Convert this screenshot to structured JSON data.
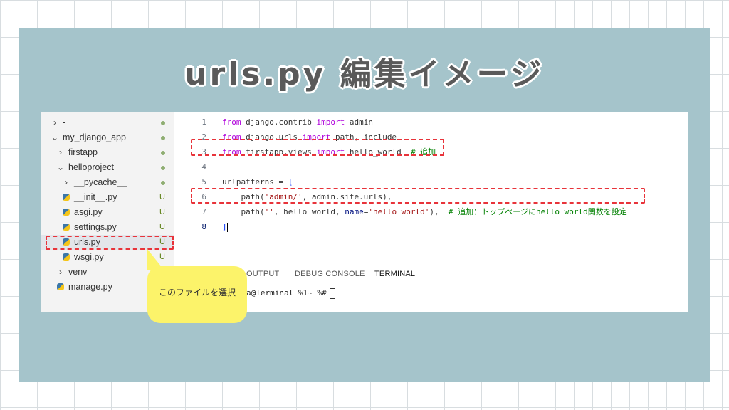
{
  "title": "urls.py 編集イメージ",
  "sidebar": {
    "items": [
      {
        "chevron": "›",
        "label": "-",
        "status": ""
      },
      {
        "chevron": "⌄",
        "label": "my_django_app",
        "status": ""
      },
      {
        "chevron": "›",
        "label": "firstapp",
        "status": ""
      },
      {
        "chevron": "⌄",
        "label": "helloproject",
        "status": ""
      },
      {
        "chevron": "›",
        "label": "__pycache__",
        "status": ""
      },
      {
        "chevron": "",
        "label": "__init__.py",
        "status": "U"
      },
      {
        "chevron": "",
        "label": "asgi.py",
        "status": "U"
      },
      {
        "chevron": "",
        "label": "settings.py",
        "status": "U"
      },
      {
        "chevron": "",
        "label": "urls.py",
        "status": "U"
      },
      {
        "chevron": "",
        "label": "wsgi.py",
        "status": "U"
      },
      {
        "chevron": "›",
        "label": "venv",
        "status": ""
      },
      {
        "chevron": "",
        "label": "manage.py",
        "status": ""
      }
    ]
  },
  "editor": {
    "line_numbers": [
      "1",
      "2",
      "3",
      "4",
      "5",
      "6",
      "7",
      "8"
    ],
    "lines": [
      {
        "l1_a": "from",
        "l1_b": " django.contrib ",
        "l1_c": "import",
        "l1_d": " admin"
      },
      {
        "l2_a": "from",
        "l2_b": " django.urls ",
        "l2_c": "import",
        "l2_d": " path, include"
      },
      {
        "l3_a": "from",
        "l3_b": " firstapp.views ",
        "l3_c": "import",
        "l3_d": " hello_world  ",
        "l3_e": "# 追加"
      },
      {},
      {
        "l5_a": "urlpatterns = ",
        "l5_b": "["
      },
      {
        "l6_a": "    path(",
        "l6_b": "'admin/'",
        "l6_c": ", admin.site.urls),"
      },
      {
        "l7_a": "    path(",
        "l7_b": "''",
        "l7_c": ", hello_world, ",
        "l7_d": "name",
        "l7_e": "=",
        "l7_f": "'hello_world'",
        "l7_g": "),  ",
        "l7_h": "# 追加：トップページにhello_world関数を設定"
      },
      {
        "l8_a": "]"
      }
    ]
  },
  "terminal": {
    "tabs": [
      "OUTPUT",
      "DEBUG CONSOLE",
      "TERMINAL"
    ],
    "active_tab": "TERMINAL",
    "prompt": "a@Terminal %1~ %#"
  },
  "callout": {
    "text": "このファイルを選択"
  },
  "colors": {
    "panel": "#a5c4cb",
    "highlight_border": "#e8333a",
    "callout": "#fcf36a"
  }
}
